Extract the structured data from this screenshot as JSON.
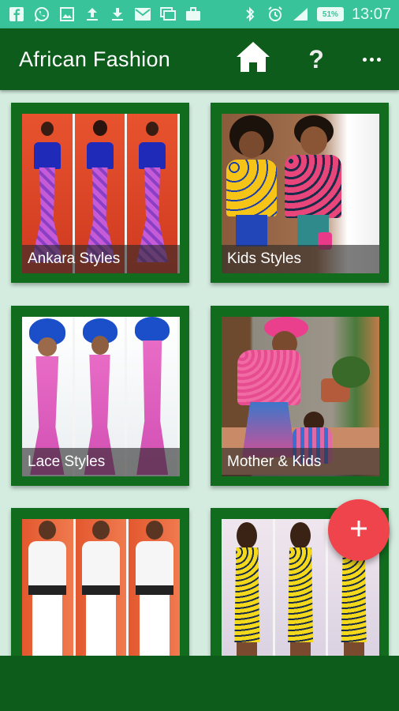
{
  "status_bar": {
    "time": "13:07",
    "battery": "51%",
    "left_icons": [
      "facebook-icon",
      "whatsapp-icon",
      "image-icon",
      "upload-icon",
      "download-icon",
      "mail-icon",
      "messages-icon",
      "briefcase-icon"
    ],
    "right_icons": [
      "bluetooth-icon",
      "alarm-icon",
      "signal-icon",
      "battery-icon"
    ]
  },
  "app_bar": {
    "title": "African Fashion",
    "home_icon": "home-icon",
    "help_label": "?",
    "more_icon": "more-vert-icon"
  },
  "grid": {
    "items": [
      {
        "label": "Ankara Styles"
      },
      {
        "label": "Kids Styles"
      },
      {
        "label": "Lace Styles"
      },
      {
        "label": "Mother & Kids"
      },
      {
        "label": ""
      },
      {
        "label": ""
      }
    ]
  },
  "fab": {
    "label": "+",
    "icon": "add-icon"
  },
  "colors": {
    "status_bar": "#39c39a",
    "app_bar": "#0d5c1b",
    "card_frame": "#116c1e",
    "background": "#d4ecdf",
    "fab": "#f0444c"
  }
}
